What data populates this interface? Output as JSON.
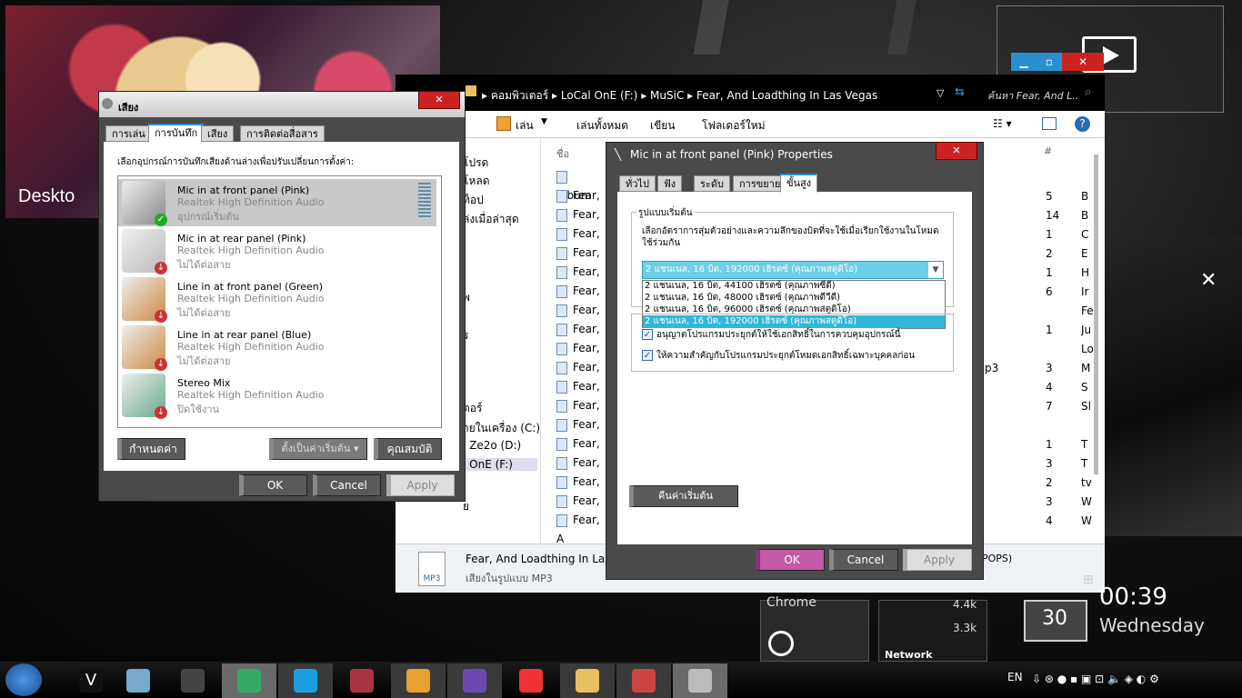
{
  "desktop": {
    "label": "Deskto"
  },
  "explorer": {
    "breadcrumb": [
      "คอมพิวเตอร์",
      "LoCal OnE (F:)",
      "MuSiC",
      "Fear, And Loadthing In Las Vegas"
    ],
    "search_placeholder": "ค้นหา Fear, And L...",
    "toolbar": {
      "play": "เล่น",
      "play_all": "เล่นทั้งหมด",
      "burn": "เขียน",
      "new_folder": "โฟลเดอร์ใหม่"
    },
    "col_name": "ชื่อ",
    "col_num": "#",
    "nav": [
      "โปรด",
      "โหลด",
      "ท็อป",
      "ล่งเมื่อล่าสุด",
      "พ",
      "ร",
      "ตอร์",
      "ายในเครื่อง (C:)",
      "l Ze2o (D:)",
      "l OnE (F:)",
      "ย"
    ],
    "files": [
      "Album",
      "Fear, A",
      "Fear, A",
      "Fear, A",
      "Fear, A",
      "Fear, A",
      "Fear, A",
      "Fear, A",
      "Fear, A",
      "Fear, A",
      "Fear, A",
      "Fear, A",
      "Fear, A",
      "Fear, A",
      "Fear, A",
      "Fear, A",
      "Fear, A",
      "Fear, A",
      "Fear, A"
    ],
    "nums": [
      "",
      "5",
      "14",
      "1",
      "2",
      "1",
      "6",
      "",
      "1",
      "",
      "3",
      "4",
      "7",
      "",
      "1",
      "3",
      "2",
      "3",
      "4"
    ],
    "lets": [
      "",
      "B",
      "B",
      "C",
      "E",
      "H",
      "Ir",
      "Fe",
      "Ju",
      "Lo",
      "M",
      "S",
      "Sl",
      "",
      "T",
      "T",
      "tv",
      "W",
      "W"
    ],
    "extra": "p3",
    "status_title": "Fear, And Loadthing In Las",
    "status_sub": "เสียงในรูปแบบ MP3",
    "status_right": "POPS)",
    "status_icon": "MP3"
  },
  "sound": {
    "title": "เสียง",
    "tabs": [
      "การเล่น",
      "การบันทึก",
      "เสียง",
      "การติดต่อสื่อสาร"
    ],
    "instruction": "เลือกอุปกรณ์การบันทึกเสียงด้านล่างเพื่อปรับเปลี่ยนการตั้งค่า:",
    "devices": [
      {
        "name": "Mic in at front panel (Pink)",
        "driver": "Realtek High Definition Audio",
        "status": "อุปกรณ์เริ่มต้น"
      },
      {
        "name": "Mic in at rear panel (Pink)",
        "driver": "Realtek High Definition Audio",
        "status": "ไม่ได้ต่อสาย"
      },
      {
        "name": "Line in at front panel (Green)",
        "driver": "Realtek High Definition Audio",
        "status": "ไม่ได้ต่อสาย"
      },
      {
        "name": "Line in at rear panel (Blue)",
        "driver": "Realtek High Definition Audio",
        "status": "ไม่ได้ต่อสาย"
      },
      {
        "name": "Stereo Mix",
        "driver": "Realtek High Definition Audio",
        "status": "ปิดใช้งาน"
      }
    ],
    "configure": "กำหนดค่า",
    "set_default": "ตั้งเป็นค่าเริ่มต้น",
    "properties": "คุณสมบัติ",
    "ok": "OK",
    "cancel": "Cancel",
    "apply": "Apply"
  },
  "props": {
    "title": "Mic in at front panel (Pink) Properties",
    "tabs": [
      "ทั่วไป",
      "ฟัง",
      "ระดับ",
      "การขยาย",
      "ขั้นสูง"
    ],
    "group": "รูปแบบเริ่มต้น",
    "desc": "เลือกอัตราการสุ่มตัวอย่างและความลึกของบิตที่จะใช้เมื่อเรียกใช้งานในโหมดใช้ร่วมกัน",
    "selected": "2 แชนเนล, 16 บิต, 192000 เฮิรตซ์ (คุณภาพสตูดิโอ)",
    "options": [
      "2 แชนเนล, 16 บิต, 44100 เฮิรตซ์ (คุณภาพซีดี)",
      "2 แชนเนล, 16 บิต, 48000 เฮิรตซ์ (คุณภาพดีวีดี)",
      "2 แชนเนล, 16 บิต, 96000 เฮิรตซ์ (คุณภาพสตูดิโอ)",
      "2 แชนเนล, 16 บิต, 192000 เฮิรตซ์ (คุณภาพสตูดิโอ)"
    ],
    "exclusive1": "อนุญาตโปรแกรมประยุกต์ให้ใช้เอกสิทธิ์ในการควบคุมอุปกรณ์นี้",
    "exclusive2": "ให้ความสำคัญกับโปรแกรมประยุกต์โหมดเอกสิทธิ์เฉพาะบุคคลก่อน",
    "restore": "คืนค่าเริ่มต้น",
    "ok": "OK",
    "cancel": "Cancel",
    "apply": "Apply"
  },
  "gadgets": {
    "chrome": "Chrome",
    "net1": "4.4k",
    "net2": "3.3k",
    "network": "Network",
    "day_num": "30",
    "time": "00:39",
    "day": "Wednesday"
  },
  "taskbar": {
    "lang": "EN",
    "v_label": "V"
  }
}
